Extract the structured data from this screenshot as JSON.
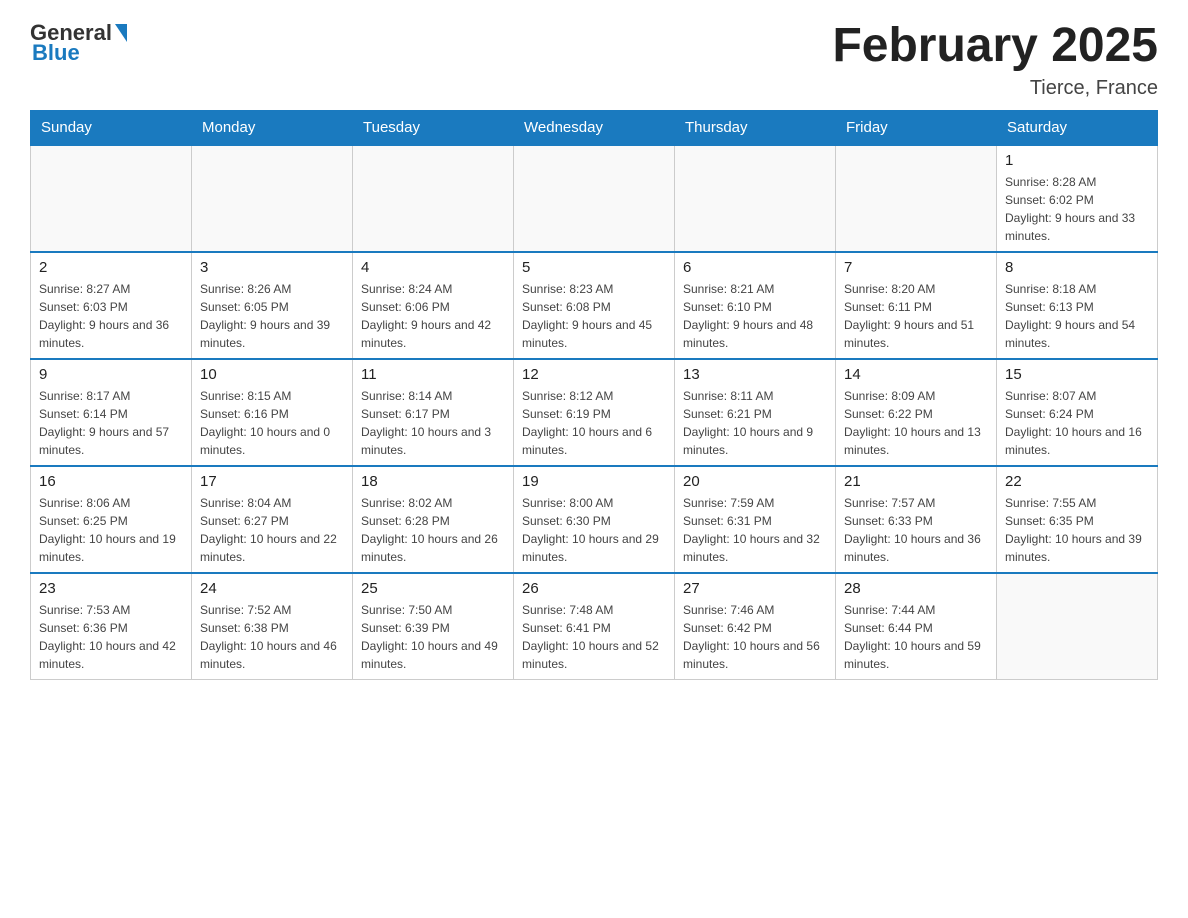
{
  "header": {
    "logo_general": "General",
    "logo_blue": "Blue",
    "month_title": "February 2025",
    "location": "Tierce, France"
  },
  "days_of_week": [
    "Sunday",
    "Monday",
    "Tuesday",
    "Wednesday",
    "Thursday",
    "Friday",
    "Saturday"
  ],
  "weeks": [
    {
      "days": [
        {
          "number": "",
          "info": "",
          "empty": true
        },
        {
          "number": "",
          "info": "",
          "empty": true
        },
        {
          "number": "",
          "info": "",
          "empty": true
        },
        {
          "number": "",
          "info": "",
          "empty": true
        },
        {
          "number": "",
          "info": "",
          "empty": true
        },
        {
          "number": "",
          "info": "",
          "empty": true
        },
        {
          "number": "1",
          "info": "Sunrise: 8:28 AM\nSunset: 6:02 PM\nDaylight: 9 hours and 33 minutes."
        }
      ]
    },
    {
      "days": [
        {
          "number": "2",
          "info": "Sunrise: 8:27 AM\nSunset: 6:03 PM\nDaylight: 9 hours and 36 minutes."
        },
        {
          "number": "3",
          "info": "Sunrise: 8:26 AM\nSunset: 6:05 PM\nDaylight: 9 hours and 39 minutes."
        },
        {
          "number": "4",
          "info": "Sunrise: 8:24 AM\nSunset: 6:06 PM\nDaylight: 9 hours and 42 minutes."
        },
        {
          "number": "5",
          "info": "Sunrise: 8:23 AM\nSunset: 6:08 PM\nDaylight: 9 hours and 45 minutes."
        },
        {
          "number": "6",
          "info": "Sunrise: 8:21 AM\nSunset: 6:10 PM\nDaylight: 9 hours and 48 minutes."
        },
        {
          "number": "7",
          "info": "Sunrise: 8:20 AM\nSunset: 6:11 PM\nDaylight: 9 hours and 51 minutes."
        },
        {
          "number": "8",
          "info": "Sunrise: 8:18 AM\nSunset: 6:13 PM\nDaylight: 9 hours and 54 minutes."
        }
      ]
    },
    {
      "days": [
        {
          "number": "9",
          "info": "Sunrise: 8:17 AM\nSunset: 6:14 PM\nDaylight: 9 hours and 57 minutes."
        },
        {
          "number": "10",
          "info": "Sunrise: 8:15 AM\nSunset: 6:16 PM\nDaylight: 10 hours and 0 minutes."
        },
        {
          "number": "11",
          "info": "Sunrise: 8:14 AM\nSunset: 6:17 PM\nDaylight: 10 hours and 3 minutes."
        },
        {
          "number": "12",
          "info": "Sunrise: 8:12 AM\nSunset: 6:19 PM\nDaylight: 10 hours and 6 minutes."
        },
        {
          "number": "13",
          "info": "Sunrise: 8:11 AM\nSunset: 6:21 PM\nDaylight: 10 hours and 9 minutes."
        },
        {
          "number": "14",
          "info": "Sunrise: 8:09 AM\nSunset: 6:22 PM\nDaylight: 10 hours and 13 minutes."
        },
        {
          "number": "15",
          "info": "Sunrise: 8:07 AM\nSunset: 6:24 PM\nDaylight: 10 hours and 16 minutes."
        }
      ]
    },
    {
      "days": [
        {
          "number": "16",
          "info": "Sunrise: 8:06 AM\nSunset: 6:25 PM\nDaylight: 10 hours and 19 minutes."
        },
        {
          "number": "17",
          "info": "Sunrise: 8:04 AM\nSunset: 6:27 PM\nDaylight: 10 hours and 22 minutes."
        },
        {
          "number": "18",
          "info": "Sunrise: 8:02 AM\nSunset: 6:28 PM\nDaylight: 10 hours and 26 minutes."
        },
        {
          "number": "19",
          "info": "Sunrise: 8:00 AM\nSunset: 6:30 PM\nDaylight: 10 hours and 29 minutes."
        },
        {
          "number": "20",
          "info": "Sunrise: 7:59 AM\nSunset: 6:31 PM\nDaylight: 10 hours and 32 minutes."
        },
        {
          "number": "21",
          "info": "Sunrise: 7:57 AM\nSunset: 6:33 PM\nDaylight: 10 hours and 36 minutes."
        },
        {
          "number": "22",
          "info": "Sunrise: 7:55 AM\nSunset: 6:35 PM\nDaylight: 10 hours and 39 minutes."
        }
      ]
    },
    {
      "days": [
        {
          "number": "23",
          "info": "Sunrise: 7:53 AM\nSunset: 6:36 PM\nDaylight: 10 hours and 42 minutes."
        },
        {
          "number": "24",
          "info": "Sunrise: 7:52 AM\nSunset: 6:38 PM\nDaylight: 10 hours and 46 minutes."
        },
        {
          "number": "25",
          "info": "Sunrise: 7:50 AM\nSunset: 6:39 PM\nDaylight: 10 hours and 49 minutes."
        },
        {
          "number": "26",
          "info": "Sunrise: 7:48 AM\nSunset: 6:41 PM\nDaylight: 10 hours and 52 minutes."
        },
        {
          "number": "27",
          "info": "Sunrise: 7:46 AM\nSunset: 6:42 PM\nDaylight: 10 hours and 56 minutes."
        },
        {
          "number": "28",
          "info": "Sunrise: 7:44 AM\nSunset: 6:44 PM\nDaylight: 10 hours and 59 minutes."
        },
        {
          "number": "",
          "info": "",
          "empty": true
        }
      ]
    }
  ]
}
